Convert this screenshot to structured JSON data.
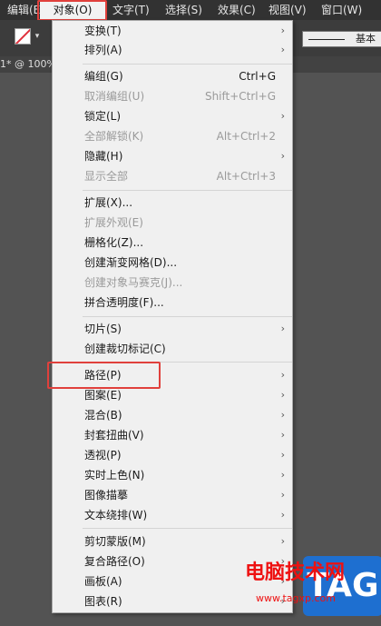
{
  "menubar": {
    "items": [
      {
        "label": "编辑(E)"
      },
      {
        "label": "对象(O)"
      },
      {
        "label": "文字(T)"
      },
      {
        "label": "选择(S)"
      },
      {
        "label": "效果(C)"
      },
      {
        "label": "视图(V)"
      },
      {
        "label": "窗口(W)"
      }
    ],
    "active_index": 1
  },
  "toolbar": {
    "stroke_style_label": "基本"
  },
  "doc_tab": {
    "title": "1* @ 100%"
  },
  "object_menu": {
    "items": [
      {
        "label": "变换(T)",
        "submenu": "›"
      },
      {
        "label": "排列(A)",
        "submenu": "›"
      },
      {
        "label": "编组(G)",
        "shortcut": "Ctrl+G"
      },
      {
        "label": "取消编组(U)",
        "shortcut": "Shift+Ctrl+G"
      },
      {
        "label": "锁定(L)",
        "submenu": "›"
      },
      {
        "label": "全部解锁(K)",
        "shortcut": "Alt+Ctrl+2"
      },
      {
        "label": "隐藏(H)",
        "submenu": "›"
      },
      {
        "label": "显示全部",
        "shortcut": "Alt+Ctrl+3"
      },
      {
        "label": "扩展(X)..."
      },
      {
        "label": "扩展外观(E)"
      },
      {
        "label": "栅格化(Z)..."
      },
      {
        "label": "创建渐变网格(D)..."
      },
      {
        "label": "创建对象马赛克(J)..."
      },
      {
        "label": "拼合透明度(F)..."
      },
      {
        "label": "切片(S)",
        "submenu": "›"
      },
      {
        "label": "创建裁切标记(C)"
      },
      {
        "label": "路径(P)",
        "submenu": "›"
      },
      {
        "label": "图案(E)",
        "submenu": "›"
      },
      {
        "label": "混合(B)",
        "submenu": "›"
      },
      {
        "label": "封套扭曲(V)",
        "submenu": "›"
      },
      {
        "label": "透视(P)",
        "submenu": "›"
      },
      {
        "label": "实时上色(N)",
        "submenu": "›"
      },
      {
        "label": "图像描摹",
        "submenu": "›"
      },
      {
        "label": "文本绕排(W)",
        "submenu": "›"
      },
      {
        "label": "剪切蒙版(M)",
        "submenu": "›"
      },
      {
        "label": "复合路径(O)",
        "submenu": "›"
      },
      {
        "label": "画板(A)",
        "submenu": "›"
      },
      {
        "label": "图表(R)",
        "submenu": "›"
      }
    ],
    "highlighted_label": "路径(P)"
  },
  "watermark": {
    "title": "电脑技术网",
    "url": "www.tagxp.com",
    "logo": "TAG"
  },
  "colors": {
    "highlight_box": "#e0403c",
    "menu_bg": "#f0f0f0",
    "menubar_bg": "#323232",
    "canvas_bg": "#535353",
    "disabled_text": "#9a9a9a",
    "watermark_red": "#ee1111",
    "watermark_blue": "#1e6fd0"
  },
  "icons": {
    "fill_swatch": "none-fill-swatch-icon",
    "submenu_arrow": "chevron-right-icon"
  }
}
